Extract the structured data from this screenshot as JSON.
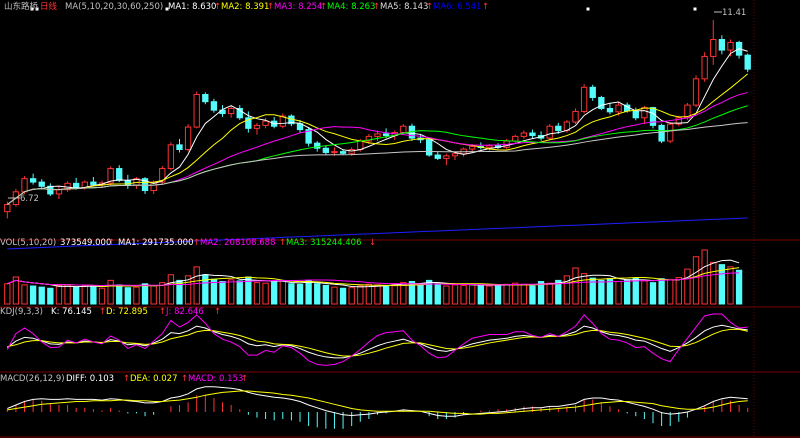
{
  "stock": {
    "name": "山东路桥",
    "period": "日线",
    "ma_label": "MA(5,10,20,30,60,250)",
    "ma_values": [
      {
        "label": "MA1: 8.630",
        "arrow": "↑",
        "color": "#ffffff"
      },
      {
        "label": "MA2: 8.391",
        "arrow": "↑",
        "color": "#ffff00"
      },
      {
        "label": "MA3: 8.254",
        "arrow": "↑",
        "color": "#ff00ff"
      },
      {
        "label": "MA4: 8.263",
        "arrow": "↑",
        "color": "#00ff00"
      },
      {
        "label": "MA5: 8.143",
        "arrow": "↑",
        "color": "#dddddd"
      },
      {
        "label": "MA6: 6.541",
        "arrow": "↑",
        "color": "#0000ff"
      }
    ],
    "high_label": "11.41",
    "low_label": "6.72"
  },
  "volume": {
    "header": "VOL(5,10,20)",
    "value": "373549.000",
    "arrow": "↑",
    "ma_values": [
      {
        "label": "MA1: 291735.000",
        "arrow": "↑",
        "color": "#ffffff"
      },
      {
        "label": "MA2: 208108.688",
        "arrow": "↑",
        "color": "#ff00ff"
      },
      {
        "label": "MA3: 315244.406",
        "arrow": "↓",
        "color": "#00ff00"
      }
    ]
  },
  "kdj": {
    "header": "KDJ(9,3,3)",
    "values": [
      {
        "label": "K: 76.145",
        "arrow": "↑",
        "color": "#ffffff"
      },
      {
        "label": "D: 72.895",
        "arrow": "↑",
        "color": "#ffff00"
      },
      {
        "label": "J: 82.646",
        "arrow": "↑",
        "color": "#ff00ff"
      }
    ]
  },
  "macd": {
    "header": "MACD(26,12,9)",
    "values": [
      {
        "label": "DIFF: 0.103",
        "arrow": "↑",
        "color": "#ffffff"
      },
      {
        "label": "DEA: 0.027",
        "arrow": "↑",
        "color": "#ffff00"
      },
      {
        "label": "MACD: 0.153",
        "arrow": "↑",
        "color": "#ff00ff"
      }
    ]
  },
  "colors": {
    "up": "#ff3232",
    "down": "#54fcfc",
    "grid": "#7a0000",
    "header_text": "#c0c0c0"
  },
  "chart_data": {
    "type": "candlestick",
    "ylim": [
      6.4,
      11.6
    ],
    "candles": [
      {
        "o": 6.88,
        "h": 7.12,
        "l": 6.72,
        "c": 7.05
      },
      {
        "o": 7.05,
        "h": 7.42,
        "l": 7.0,
        "c": 7.35
      },
      {
        "o": 7.35,
        "h": 7.72,
        "l": 7.3,
        "c": 7.66
      },
      {
        "o": 7.66,
        "h": 7.78,
        "l": 7.52,
        "c": 7.58
      },
      {
        "o": 7.58,
        "h": 7.65,
        "l": 7.42,
        "c": 7.48
      },
      {
        "o": 7.48,
        "h": 7.55,
        "l": 7.25,
        "c": 7.3
      },
      {
        "o": 7.3,
        "h": 7.48,
        "l": 7.18,
        "c": 7.4
      },
      {
        "o": 7.4,
        "h": 7.6,
        "l": 7.35,
        "c": 7.55
      },
      {
        "o": 7.55,
        "h": 7.68,
        "l": 7.4,
        "c": 7.45
      },
      {
        "o": 7.45,
        "h": 7.62,
        "l": 7.4,
        "c": 7.58
      },
      {
        "o": 7.58,
        "h": 7.7,
        "l": 7.48,
        "c": 7.52
      },
      {
        "o": 7.52,
        "h": 7.62,
        "l": 7.44,
        "c": 7.56
      },
      {
        "o": 7.56,
        "h": 7.95,
        "l": 7.5,
        "c": 7.9
      },
      {
        "o": 7.9,
        "h": 7.98,
        "l": 7.58,
        "c": 7.62
      },
      {
        "o": 7.62,
        "h": 7.75,
        "l": 7.42,
        "c": 7.5
      },
      {
        "o": 7.5,
        "h": 7.7,
        "l": 7.42,
        "c": 7.66
      },
      {
        "o": 7.66,
        "h": 7.7,
        "l": 7.3,
        "c": 7.38
      },
      {
        "o": 7.38,
        "h": 7.62,
        "l": 7.3,
        "c": 7.58
      },
      {
        "o": 7.58,
        "h": 7.96,
        "l": 7.52,
        "c": 7.9
      },
      {
        "o": 7.9,
        "h": 8.52,
        "l": 7.85,
        "c": 8.46
      },
      {
        "o": 8.46,
        "h": 8.6,
        "l": 8.28,
        "c": 8.35
      },
      {
        "o": 8.35,
        "h": 8.95,
        "l": 8.3,
        "c": 8.88
      },
      {
        "o": 8.88,
        "h": 9.72,
        "l": 8.85,
        "c": 9.65
      },
      {
        "o": 9.65,
        "h": 9.7,
        "l": 9.42,
        "c": 9.48
      },
      {
        "o": 9.48,
        "h": 9.55,
        "l": 9.22,
        "c": 9.28
      },
      {
        "o": 9.28,
        "h": 9.4,
        "l": 9.12,
        "c": 9.2
      },
      {
        "o": 9.2,
        "h": 9.38,
        "l": 9.1,
        "c": 9.32
      },
      {
        "o": 9.32,
        "h": 9.4,
        "l": 9.05,
        "c": 9.1
      },
      {
        "o": 9.1,
        "h": 9.25,
        "l": 8.75,
        "c": 8.85
      },
      {
        "o": 8.85,
        "h": 8.98,
        "l": 8.7,
        "c": 8.92
      },
      {
        "o": 8.92,
        "h": 9.1,
        "l": 8.85,
        "c": 9.02
      },
      {
        "o": 9.02,
        "h": 9.12,
        "l": 8.85,
        "c": 8.9
      },
      {
        "o": 8.9,
        "h": 9.2,
        "l": 8.85,
        "c": 9.14
      },
      {
        "o": 9.14,
        "h": 9.18,
        "l": 8.9,
        "c": 8.96
      },
      {
        "o": 8.96,
        "h": 9.05,
        "l": 8.75,
        "c": 8.82
      },
      {
        "o": 8.82,
        "h": 8.88,
        "l": 8.42,
        "c": 8.5
      },
      {
        "o": 8.5,
        "h": 8.55,
        "l": 8.3,
        "c": 8.38
      },
      {
        "o": 8.38,
        "h": 8.45,
        "l": 8.22,
        "c": 8.28
      },
      {
        "o": 8.28,
        "h": 8.4,
        "l": 8.2,
        "c": 8.3
      },
      {
        "o": 8.3,
        "h": 8.34,
        "l": 8.22,
        "c": 8.26
      },
      {
        "o": 8.26,
        "h": 8.4,
        "l": 8.2,
        "c": 8.35
      },
      {
        "o": 8.35,
        "h": 8.6,
        "l": 8.3,
        "c": 8.55
      },
      {
        "o": 8.55,
        "h": 8.72,
        "l": 8.48,
        "c": 8.66
      },
      {
        "o": 8.66,
        "h": 8.8,
        "l": 8.55,
        "c": 8.72
      },
      {
        "o": 8.72,
        "h": 8.85,
        "l": 8.62,
        "c": 8.68
      },
      {
        "o": 8.68,
        "h": 8.8,
        "l": 8.58,
        "c": 8.75
      },
      {
        "o": 8.75,
        "h": 8.95,
        "l": 8.7,
        "c": 8.9
      },
      {
        "o": 8.9,
        "h": 8.96,
        "l": 8.55,
        "c": 8.62
      },
      {
        "o": 8.62,
        "h": 8.72,
        "l": 8.5,
        "c": 8.58
      },
      {
        "o": 8.58,
        "h": 8.62,
        "l": 8.18,
        "c": 8.22
      },
      {
        "o": 8.22,
        "h": 8.3,
        "l": 8.1,
        "c": 8.14
      },
      {
        "o": 8.14,
        "h": 8.25,
        "l": 7.98,
        "c": 8.2
      },
      {
        "o": 8.2,
        "h": 8.3,
        "l": 8.1,
        "c": 8.25
      },
      {
        "o": 8.25,
        "h": 8.4,
        "l": 8.18,
        "c": 8.36
      },
      {
        "o": 8.36,
        "h": 8.48,
        "l": 8.3,
        "c": 8.42
      },
      {
        "o": 8.42,
        "h": 8.52,
        "l": 8.35,
        "c": 8.4
      },
      {
        "o": 8.4,
        "h": 8.48,
        "l": 8.32,
        "c": 8.44
      },
      {
        "o": 8.44,
        "h": 8.5,
        "l": 8.36,
        "c": 8.4
      },
      {
        "o": 8.4,
        "h": 8.6,
        "l": 8.36,
        "c": 8.55
      },
      {
        "o": 8.55,
        "h": 8.7,
        "l": 8.5,
        "c": 8.66
      },
      {
        "o": 8.66,
        "h": 8.8,
        "l": 8.6,
        "c": 8.74
      },
      {
        "o": 8.74,
        "h": 8.82,
        "l": 8.62,
        "c": 8.68
      },
      {
        "o": 8.68,
        "h": 8.78,
        "l": 8.56,
        "c": 8.62
      },
      {
        "o": 8.62,
        "h": 8.95,
        "l": 8.58,
        "c": 8.9
      },
      {
        "o": 8.9,
        "h": 8.98,
        "l": 8.72,
        "c": 8.8
      },
      {
        "o": 8.8,
        "h": 9.05,
        "l": 8.75,
        "c": 9.0
      },
      {
        "o": 9.0,
        "h": 9.32,
        "l": 8.95,
        "c": 9.25
      },
      {
        "o": 9.25,
        "h": 9.9,
        "l": 9.2,
        "c": 9.82
      },
      {
        "o": 9.82,
        "h": 9.88,
        "l": 9.5,
        "c": 9.58
      },
      {
        "o": 9.58,
        "h": 9.62,
        "l": 9.28,
        "c": 9.32
      },
      {
        "o": 9.32,
        "h": 9.45,
        "l": 9.18,
        "c": 9.24
      },
      {
        "o": 9.24,
        "h": 9.48,
        "l": 9.15,
        "c": 9.4
      },
      {
        "o": 9.4,
        "h": 9.46,
        "l": 9.22,
        "c": 9.26
      },
      {
        "o": 9.26,
        "h": 9.34,
        "l": 9.04,
        "c": 9.1
      },
      {
        "o": 9.1,
        "h": 9.38,
        "l": 8.95,
        "c": 9.34
      },
      {
        "o": 9.34,
        "h": 9.36,
        "l": 8.85,
        "c": 8.92
      },
      {
        "o": 8.92,
        "h": 8.96,
        "l": 8.5,
        "c": 8.55
      },
      {
        "o": 8.55,
        "h": 9.0,
        "l": 8.5,
        "c": 8.95
      },
      {
        "o": 8.95,
        "h": 9.15,
        "l": 8.9,
        "c": 9.1
      },
      {
        "o": 9.1,
        "h": 9.45,
        "l": 9.05,
        "c": 9.4
      },
      {
        "o": 9.4,
        "h": 10.1,
        "l": 9.35,
        "c": 10.02
      },
      {
        "o": 10.02,
        "h": 10.65,
        "l": 9.95,
        "c": 10.55
      },
      {
        "o": 10.55,
        "h": 11.41,
        "l": 10.35,
        "c": 10.95
      },
      {
        "o": 10.95,
        "h": 11.05,
        "l": 10.6,
        "c": 10.7
      },
      {
        "o": 10.7,
        "h": 10.95,
        "l": 10.55,
        "c": 10.88
      },
      {
        "o": 10.88,
        "h": 10.92,
        "l": 10.5,
        "c": 10.58
      },
      {
        "o": 10.58,
        "h": 10.62,
        "l": 10.18,
        "c": 10.25
      }
    ],
    "volume": [
      180,
      240,
      170,
      160,
      150,
      140,
      165,
      170,
      150,
      160,
      150,
      140,
      210,
      170,
      145,
      150,
      180,
      165,
      190,
      260,
      210,
      250,
      330,
      260,
      220,
      200,
      215,
      205,
      240,
      190,
      185,
      195,
      205,
      180,
      175,
      210,
      180,
      165,
      150,
      140,
      145,
      160,
      175,
      170,
      165,
      180,
      190,
      200,
      175,
      210,
      180,
      160,
      170,
      165,
      175,
      170,
      160,
      165,
      175,
      185,
      175,
      160,
      200,
      185,
      210,
      250,
      320,
      270,
      230,
      210,
      225,
      200,
      215,
      230,
      205,
      190,
      225,
      215,
      235,
      310,
      420,
      480,
      370,
      350,
      330,
      300
    ],
    "kdj": {
      "k": [
        38,
        52,
        60,
        58,
        52,
        46,
        45,
        50,
        48,
        52,
        50,
        48,
        55,
        52,
        44,
        46,
        42,
        48,
        56,
        70,
        68,
        74,
        84,
        80,
        72,
        66,
        62,
        56,
        46,
        42,
        44,
        40,
        44,
        42,
        36,
        28,
        22,
        18,
        16,
        16,
        20,
        26,
        34,
        42,
        48,
        52,
        56,
        50,
        46,
        38,
        32,
        30,
        34,
        40,
        46,
        50,
        54,
        56,
        58,
        62,
        64,
        62,
        60,
        64,
        62,
        66,
        72,
        84,
        80,
        72,
        66,
        64,
        60,
        54,
        52,
        44,
        36,
        30,
        38,
        48,
        60,
        74,
        82,
        86,
        82,
        78,
        76
      ],
      "d": [
        40,
        44,
        50,
        53,
        53,
        50,
        48,
        48,
        48,
        50,
        50,
        49,
        51,
        51,
        48,
        47,
        45,
        46,
        50,
        57,
        61,
        65,
        72,
        75,
        74,
        71,
        68,
        64,
        58,
        52,
        50,
        46,
        45,
        44,
        41,
        37,
        32,
        27,
        23,
        20,
        20,
        22,
        26,
        31,
        37,
        42,
        47,
        48,
        48,
        44,
        40,
        36,
        35,
        37,
        40,
        44,
        48,
        51,
        54,
        57,
        60,
        61,
        60,
        62,
        62,
        63,
        66,
        72,
        75,
        74,
        71,
        69,
        66,
        62,
        58,
        53,
        47,
        41,
        40,
        43,
        49,
        58,
        67,
        74,
        77,
        77,
        73
      ]
    },
    "macd": {
      "diff": [
        0.05,
        0.1,
        0.15,
        0.18,
        0.19,
        0.18,
        0.18,
        0.19,
        0.18,
        0.18,
        0.18,
        0.17,
        0.19,
        0.18,
        0.16,
        0.15,
        0.13,
        0.13,
        0.15,
        0.2,
        0.22,
        0.26,
        0.33,
        0.36,
        0.36,
        0.35,
        0.34,
        0.32,
        0.28,
        0.25,
        0.23,
        0.21,
        0.2,
        0.18,
        0.15,
        0.1,
        0.06,
        0.02,
        -0.01,
        -0.04,
        -0.05,
        -0.04,
        -0.03,
        -0.01,
        0.0,
        0.01,
        0.03,
        0.02,
        0.01,
        -0.02,
        -0.05,
        -0.06,
        -0.06,
        -0.04,
        -0.03,
        -0.02,
        -0.01,
        0.0,
        0.01,
        0.03,
        0.05,
        0.06,
        0.06,
        0.08,
        0.08,
        0.1,
        0.12,
        0.18,
        0.2,
        0.2,
        0.18,
        0.17,
        0.14,
        0.11,
        0.08,
        0.04,
        -0.01,
        -0.03,
        -0.02,
        0.0,
        0.04,
        0.09,
        0.15,
        0.19,
        0.21,
        0.2,
        0.19
      ],
      "dea": [
        0.03,
        0.05,
        0.07,
        0.09,
        0.11,
        0.12,
        0.13,
        0.14,
        0.15,
        0.15,
        0.16,
        0.16,
        0.16,
        0.17,
        0.17,
        0.16,
        0.16,
        0.15,
        0.15,
        0.16,
        0.17,
        0.19,
        0.21,
        0.24,
        0.26,
        0.28,
        0.29,
        0.3,
        0.3,
        0.29,
        0.28,
        0.27,
        0.25,
        0.24,
        0.22,
        0.2,
        0.17,
        0.14,
        0.11,
        0.08,
        0.05,
        0.03,
        0.02,
        0.01,
        0.01,
        0.01,
        0.01,
        0.01,
        0.01,
        0.01,
        0.0,
        -0.01,
        -0.02,
        -0.02,
        -0.03,
        -0.03,
        -0.02,
        -0.02,
        -0.01,
        0.0,
        0.01,
        0.02,
        0.03,
        0.04,
        0.05,
        0.06,
        0.07,
        0.09,
        0.11,
        0.13,
        0.14,
        0.15,
        0.15,
        0.14,
        0.13,
        0.12,
        0.09,
        0.07,
        0.05,
        0.04,
        0.04,
        0.05,
        0.07,
        0.1,
        0.13,
        0.15,
        0.16
      ]
    }
  }
}
